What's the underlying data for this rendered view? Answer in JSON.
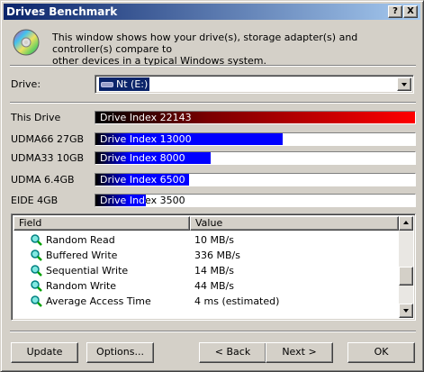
{
  "window": {
    "title": "Drives Benchmark",
    "help_button": "?",
    "close_button": "X"
  },
  "intro": {
    "icon": "cd-disc-icon",
    "text": "This window shows how your drive(s), storage adapter(s) and controller(s) compare to\nother devices in a typical Windows system."
  },
  "drive_select": {
    "label": "Drive:",
    "selected_value": "Nt (E:)",
    "options": [
      "Nt (E:)"
    ]
  },
  "benchmarks": [
    {
      "name": "This Drive",
      "bar_text": "Drive Index 22143",
      "index": 22143,
      "color": "gradient-dark-red-to-red"
    },
    {
      "name": "UDMA66 27GB",
      "bar_text": "Drive Index 13000",
      "index": 13000,
      "color": "#0000ff"
    },
    {
      "name": "UDMA33 10GB",
      "bar_text": "Drive Index 8000",
      "index": 8000,
      "color": "#0000ff"
    },
    {
      "name": "UDMA 6.4GB",
      "bar_text": "Drive Index 6500",
      "index": 6500,
      "color": "#0000ff"
    },
    {
      "name": "EIDE 4GB",
      "bar_text": "Drive Index 3500",
      "index": 3500,
      "color": "#0000ff"
    }
  ],
  "results": {
    "columns": [
      "Field",
      "Value"
    ],
    "rows": [
      {
        "icon": "magnifier-icon",
        "field": "Random Read",
        "value": "10 MB/s"
      },
      {
        "icon": "magnifier-icon",
        "field": "Buffered Write",
        "value": "336 MB/s"
      },
      {
        "icon": "magnifier-icon",
        "field": "Sequential Write",
        "value": "14 MB/s"
      },
      {
        "icon": "magnifier-icon",
        "field": "Random Write",
        "value": "44 MB/s"
      },
      {
        "icon": "magnifier-icon",
        "field": "Average Access Time",
        "value": "4 ms (estimated)"
      }
    ]
  },
  "buttons": {
    "update": "Update",
    "options": "Options...",
    "back": "< Back",
    "next": "Next >",
    "ok": "OK"
  }
}
